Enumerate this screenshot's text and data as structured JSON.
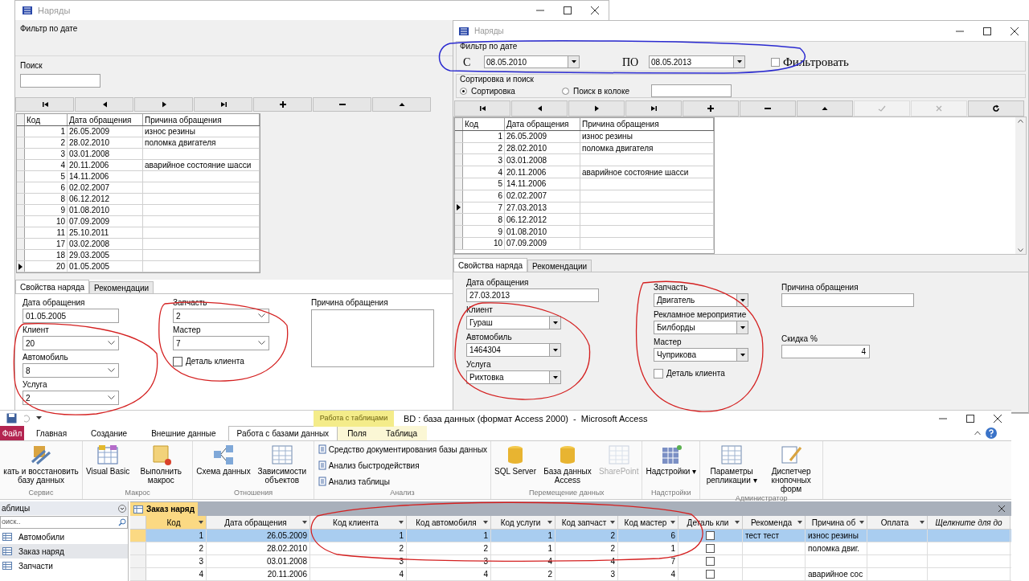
{
  "left_window": {
    "title": "Наряды",
    "filter_label": "Фильтр по дате",
    "search_label": "Поиск",
    "nav_buttons": [
      {
        "kind": "first"
      },
      {
        "kind": "prev"
      },
      {
        "kind": "next"
      },
      {
        "kind": "last"
      },
      {
        "kind": "add"
      },
      {
        "kind": "delete"
      },
      {
        "kind": "up"
      }
    ],
    "grid": {
      "columns": [
        "Код",
        "Дата обращения",
        "Причина обращения"
      ],
      "rows": [
        {
          "cells": [
            "1",
            "26.05.2009",
            "износ резины"
          ],
          "selected": false
        },
        {
          "cells": [
            "2",
            "28.02.2010",
            "поломка двигателя"
          ],
          "selected": false
        },
        {
          "cells": [
            "3",
            "03.01.2008",
            ""
          ],
          "selected": false
        },
        {
          "cells": [
            "4",
            "20.11.2006",
            "аварийное состояние шасси"
          ],
          "selected": false
        },
        {
          "cells": [
            "5",
            "14.11.2006",
            ""
          ],
          "selected": false
        },
        {
          "cells": [
            "6",
            "02.02.2007",
            ""
          ],
          "selected": false
        },
        {
          "cells": [
            "8",
            "06.12.2012",
            ""
          ],
          "selected": false
        },
        {
          "cells": [
            "9",
            "01.08.2010",
            ""
          ],
          "selected": false
        },
        {
          "cells": [
            "10",
            "07.09.2009",
            ""
          ],
          "selected": false
        },
        {
          "cells": [
            "11",
            "25.10.2011",
            ""
          ],
          "selected": false
        },
        {
          "cells": [
            "17",
            "03.02.2008",
            ""
          ],
          "selected": false
        },
        {
          "cells": [
            "18",
            "29.03.2005",
            ""
          ],
          "selected": false
        },
        {
          "cells": [
            "20",
            "01.05.2005",
            ""
          ],
          "selected": true
        }
      ]
    },
    "tabs": [
      {
        "label": "Свойства наряда",
        "selected": true
      },
      {
        "label": "Рекомендации",
        "selected": false
      }
    ],
    "field_columns": [
      [
        {
          "kind": "text",
          "label": "Дата обращения",
          "value": "01.05.2005"
        },
        {
          "kind": "combo",
          "label": "Клиент",
          "value": "20"
        },
        {
          "kind": "combo",
          "label": "Автомобиль",
          "value": "8"
        },
        {
          "kind": "combo",
          "label": "Услуга",
          "value": "2"
        }
      ],
      [
        {
          "kind": "combo",
          "label": "Запчасть",
          "value": "2"
        },
        {
          "kind": "combo",
          "label": "Мастер",
          "value": "7"
        },
        {
          "kind": "checkbox",
          "label": "Деталь клиента",
          "checked": false
        }
      ],
      [
        {
          "kind": "memo",
          "label": "Причина обращения"
        }
      ]
    ]
  },
  "right_window": {
    "title": "Наряды",
    "filter": {
      "label": "Фильтр по дате",
      "from_label": "С",
      "from": "08.05.2010",
      "to_label": "ПО",
      "to": "08.05.2013",
      "apply_label": "Фильтровать",
      "apply_checked": false
    },
    "sort": {
      "label": "Сортировка и поиск",
      "options": [
        {
          "label": "Сортировка",
          "selected": true
        },
        {
          "label": "Поиск в колоке",
          "selected": false
        }
      ]
    },
    "nav_buttons": [
      {
        "kind": "first",
        "disabled": false
      },
      {
        "kind": "prev",
        "disabled": false
      },
      {
        "kind": "next",
        "disabled": false
      },
      {
        "kind": "last",
        "disabled": false
      },
      {
        "kind": "add",
        "disabled": false
      },
      {
        "kind": "delete",
        "disabled": false
      },
      {
        "kind": "up",
        "disabled": false
      },
      {
        "kind": "confirm",
        "disabled": true
      },
      {
        "kind": "cancel",
        "disabled": true
      },
      {
        "kind": "refresh",
        "disabled": false
      }
    ],
    "grid": {
      "columns": [
        "Код",
        "Дата обращения",
        "Причина обращения"
      ],
      "rows": [
        {
          "cells": [
            "1",
            "26.05.2009",
            "износ резины"
          ],
          "selected": false
        },
        {
          "cells": [
            "2",
            "28.02.2010",
            "поломка двигателя"
          ],
          "selected": false
        },
        {
          "cells": [
            "3",
            "03.01.2008",
            ""
          ],
          "selected": false
        },
        {
          "cells": [
            "4",
            "20.11.2006",
            "аварийное состояние шасси"
          ],
          "selected": false
        },
        {
          "cells": [
            "5",
            "14.11.2006",
            ""
          ],
          "selected": false
        },
        {
          "cells": [
            "6",
            "02.02.2007",
            ""
          ],
          "selected": false
        },
        {
          "cells": [
            "7",
            "27.03.2013",
            ""
          ],
          "selected": true
        },
        {
          "cells": [
            "8",
            "06.12.2012",
            ""
          ],
          "selected": false
        },
        {
          "cells": [
            "9",
            "01.08.2010",
            ""
          ],
          "selected": false
        },
        {
          "cells": [
            "10",
            "07.09.2009",
            ""
          ],
          "selected": false
        }
      ]
    },
    "tabs": [
      {
        "label": "Свойства наряда",
        "selected": true
      },
      {
        "label": "Рекомендации",
        "selected": false
      }
    ],
    "field_columns": [
      [
        {
          "kind": "text",
          "label": "Дата обращения",
          "value": "27.03.2013"
        },
        {
          "kind": "combo",
          "label": "Клиент",
          "value": "Гураш"
        },
        {
          "kind": "combo",
          "label": "Автомобиль",
          "value": "1464304"
        },
        {
          "kind": "combo",
          "label": "Услуга",
          "value": "Рихтовка"
        }
      ],
      [
        {
          "kind": "combo",
          "label": "Запчасть",
          "value": "Двигатель"
        },
        {
          "kind": "combo",
          "label": "Рекламное мероприятие",
          "value": "Билборды"
        },
        {
          "kind": "combo",
          "label": "Мастер",
          "value": "Чуприкова"
        },
        {
          "kind": "checkbox",
          "label": "Деталь клиента",
          "checked": false
        }
      ],
      [
        {
          "kind": "text",
          "label": "Причина обращения"
        },
        {
          "kind": "number",
          "label": "Скидка %",
          "value": "4"
        }
      ]
    ]
  },
  "access_window": {
    "title": "BD : база данных (формат Access 2000)  -  Microsoft Access",
    "context_group": "Работа с таблицами",
    "ribbon_tabs": [
      {
        "label": "Файл",
        "kind": "file",
        "selected": false
      },
      {
        "label": "Главная",
        "kind": "tab",
        "selected": false
      },
      {
        "label": "Создание",
        "kind": "tab",
        "selected": false
      },
      {
        "label": "Внешние данные",
        "kind": "tab",
        "selected": false
      },
      {
        "label": "Работа с базами данных",
        "kind": "tab",
        "selected": true
      },
      {
        "label": "Поля",
        "kind": "context",
        "selected": false
      },
      {
        "label": "Таблица",
        "kind": "context",
        "selected": false
      }
    ],
    "ribbon_groups": [
      {
        "label": "Сервис",
        "items": [
          {
            "kind": "large",
            "label": "кать и восстановить базу данных",
            "disabled": false
          }
        ]
      },
      {
        "label": "Макрос",
        "items": [
          {
            "kind": "large",
            "label": "Visual Basic",
            "disabled": false
          },
          {
            "kind": "large",
            "label": "Выполнить макрос",
            "disabled": false
          }
        ]
      },
      {
        "label": "Отношения",
        "items": [
          {
            "kind": "large",
            "label": "Схема данных",
            "disabled": false
          },
          {
            "kind": "large",
            "label": "Зависимости объектов",
            "disabled": false
          }
        ]
      },
      {
        "label": "Анализ",
        "items": [
          {
            "kind": "small",
            "label": "Средство документирования базы данных",
            "disabled": false
          },
          {
            "kind": "small",
            "label": "Анализ быстродействия",
            "disabled": false
          },
          {
            "kind": "small",
            "label": "Анализ таблицы",
            "disabled": false
          }
        ]
      },
      {
        "label": "Перемещение данных",
        "items": [
          {
            "kind": "large",
            "label": "SQL Server",
            "disabled": false
          },
          {
            "kind": "large",
            "label": "База данных Access",
            "disabled": false
          },
          {
            "kind": "large",
            "label": "SharePoint",
            "disabled": true
          }
        ]
      },
      {
        "label": "Надстройки",
        "items": [
          {
            "kind": "large",
            "label": "Надстройки",
            "menu_arrow": "▾",
            "disabled": false
          }
        ]
      },
      {
        "label": "Администратор",
        "items": [
          {
            "kind": "large",
            "label": "Параметры репликации",
            "menu_arrow": "▾",
            "disabled": false
          },
          {
            "kind": "large",
            "label": "Диспетчер кнопочных форм",
            "disabled": false
          }
        ]
      }
    ],
    "nav_pane": {
      "title": "аблицы",
      "search_placeholder": "оиск..",
      "items": [
        {
          "label": "Автомобили",
          "selected": false
        },
        {
          "label": "Заказ наряд",
          "selected": true
        },
        {
          "label": "Запчасти",
          "selected": false
        }
      ]
    },
    "doc_tab": "Заказ наряд",
    "table": {
      "columns": [
        {
          "label": "Код",
          "kind": "num"
        },
        {
          "label": "Дата обращения",
          "kind": "num"
        },
        {
          "label": "Код клиента",
          "kind": "num"
        },
        {
          "label": "Код автомобиля",
          "kind": "num"
        },
        {
          "label": "Код услуги",
          "kind": "num"
        },
        {
          "label": "Код запчаст",
          "kind": "num"
        },
        {
          "label": "Код мастер",
          "kind": "num"
        },
        {
          "label": "Деталь кли",
          "kind": "check"
        },
        {
          "label": "Рекоменда",
          "kind": "text"
        },
        {
          "label": "Причина об",
          "kind": "text"
        },
        {
          "label": "Оплата",
          "kind": "text"
        },
        {
          "label": "Щелкните для до",
          "kind": "add"
        }
      ],
      "rows": [
        {
          "selected": true,
          "cells": [
            "1",
            "26.05.2009",
            "1",
            "1",
            "1",
            "2",
            "6",
            false,
            "тест тест",
            "износ резины",
            "",
            ""
          ]
        },
        {
          "selected": false,
          "cells": [
            "2",
            "28.02.2010",
            "2",
            "2",
            "1",
            "2",
            "1",
            false,
            "",
            "поломка двиг.",
            "",
            ""
          ]
        },
        {
          "selected": false,
          "cells": [
            "3",
            "03.01.2008",
            "3",
            "3",
            "4",
            "4",
            "7",
            false,
            "",
            "",
            "",
            ""
          ]
        },
        {
          "selected": false,
          "cells": [
            "4",
            "20.11.2006",
            "4",
            "4",
            "2",
            "3",
            "4",
            false,
            "",
            "аварийное сос",
            "",
            ""
          ]
        }
      ]
    }
  }
}
